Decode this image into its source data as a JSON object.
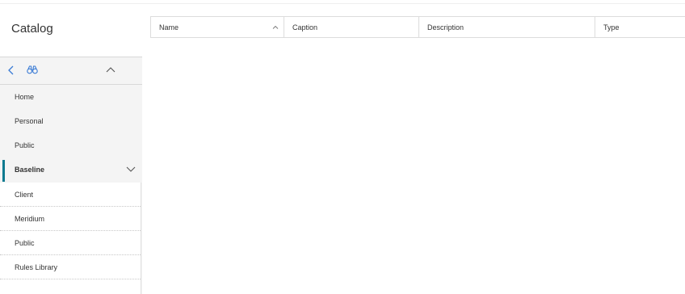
{
  "page": {
    "title": "Catalog"
  },
  "grid": {
    "columns": [
      {
        "label": "Name",
        "sorted": "ascending"
      },
      {
        "label": "Caption"
      },
      {
        "label": "Description"
      },
      {
        "label": "Type"
      }
    ]
  },
  "sidebar": {
    "toolbar_icons": [
      "chevron-left-icon",
      "binoculars-icon",
      "chevron-up-icon"
    ],
    "items": [
      {
        "label": "Home"
      },
      {
        "label": "Personal"
      },
      {
        "label": "Public"
      },
      {
        "label": "Baseline",
        "active": true,
        "expanded": true
      }
    ],
    "subitems": [
      {
        "label": "Client"
      },
      {
        "label": "Meridium"
      },
      {
        "label": "Public"
      },
      {
        "label": "Rules Library"
      }
    ]
  },
  "colors": {
    "accent": "#0b7a8f",
    "icon_blue": "#3a7bd5",
    "sidebar_bg": "#f4f4f4"
  }
}
